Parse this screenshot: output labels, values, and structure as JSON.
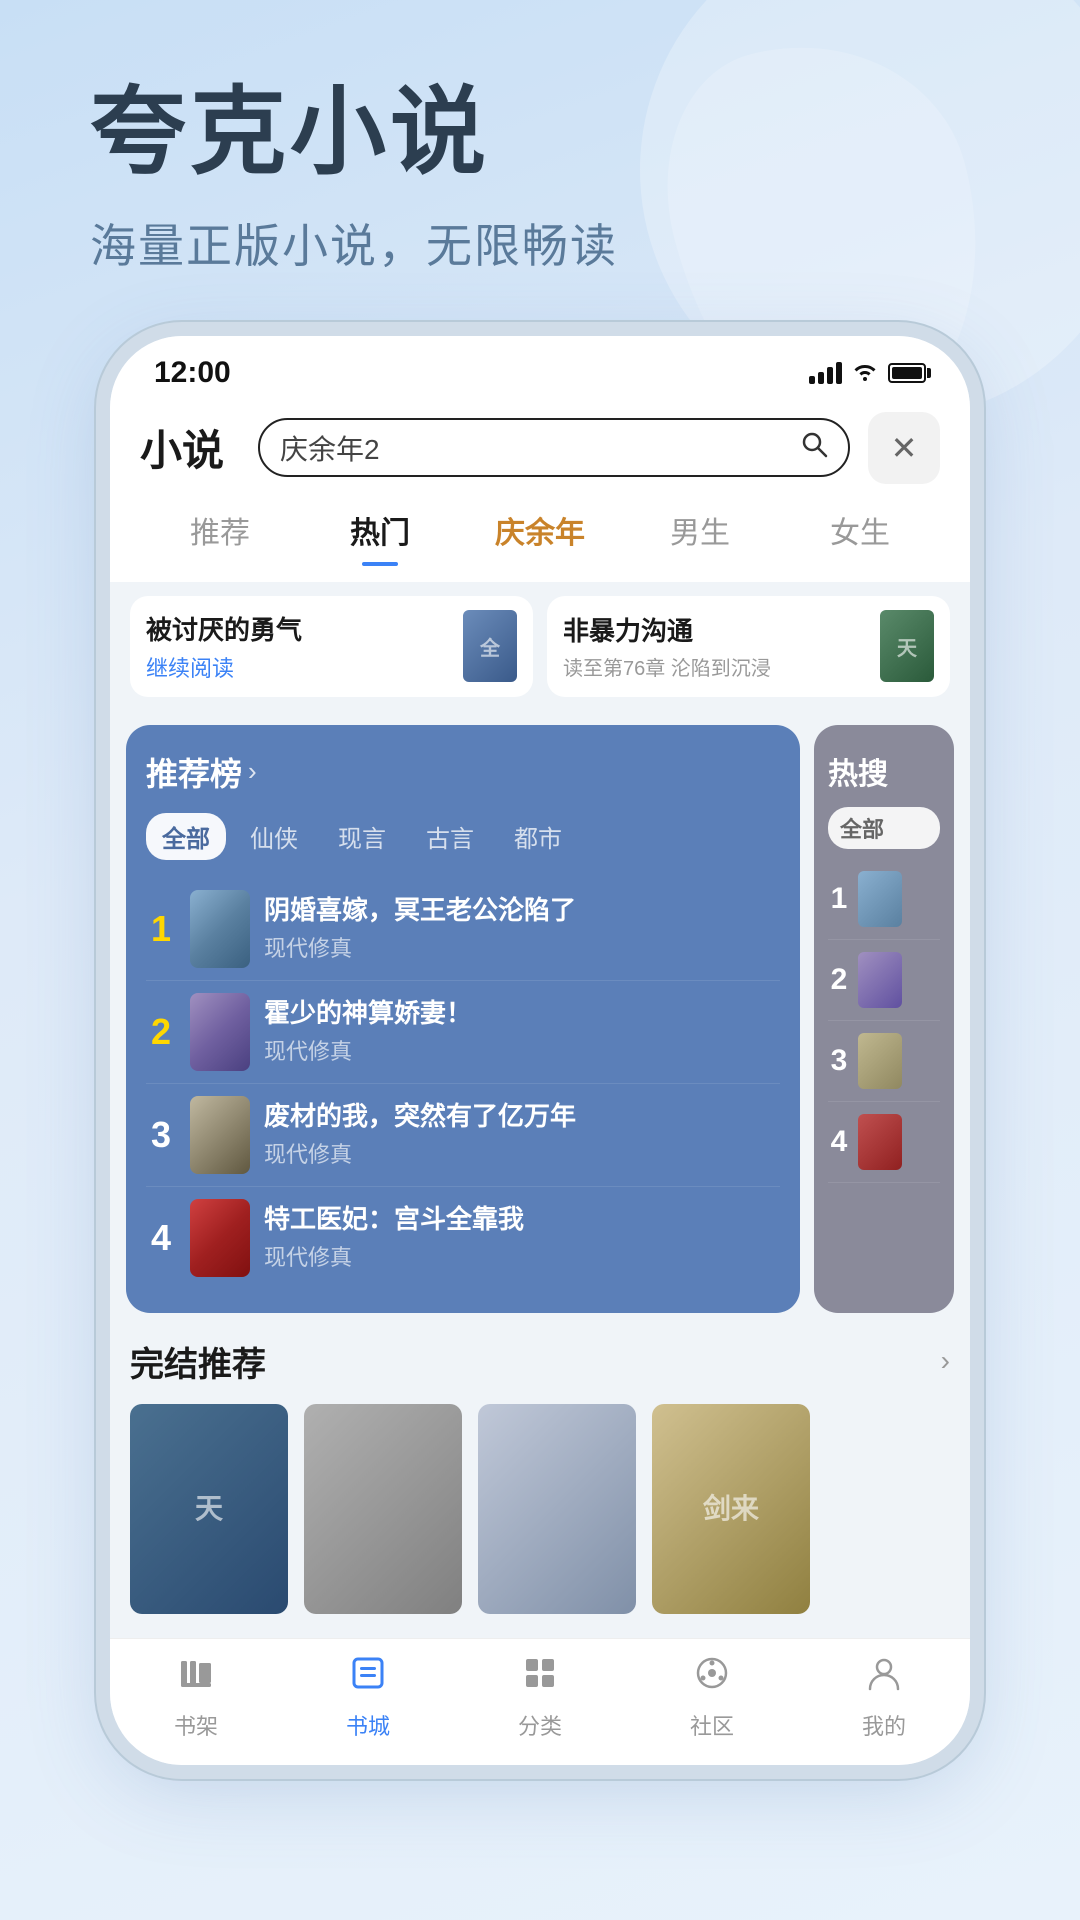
{
  "app": {
    "title": "夸克小说",
    "subtitle": "海量正版小说，无限畅读",
    "status_time": "12:00"
  },
  "header": {
    "logo": "小说",
    "search_placeholder": "庆余年2",
    "search_value": "庆余年2"
  },
  "nav_tabs": [
    {
      "label": "推荐",
      "active": false,
      "special": false
    },
    {
      "label": "热门",
      "active": true,
      "special": false
    },
    {
      "label": "庆余年",
      "active": false,
      "special": true
    },
    {
      "label": "男生",
      "active": false,
      "special": false
    },
    {
      "label": "女生",
      "active": false,
      "special": false
    }
  ],
  "recent_reads": [
    {
      "title": "被讨厌的勇气",
      "sub": "继续阅读",
      "sub_type": "action"
    },
    {
      "title": "非暴力沟通",
      "sub": "读至第76章 沦陷到沉浸",
      "sub_type": "progress"
    }
  ],
  "recommend_panel": {
    "title": "推荐榜",
    "arrow": "›",
    "filter_tabs": [
      "全部",
      "仙侠",
      "现言",
      "古言",
      "都市"
    ],
    "active_filter": "全部",
    "books": [
      {
        "rank": "1",
        "title": "阴婚喜嫁，冥王老公沦陷了",
        "genre": "现代修真",
        "cover_class": "cover-1"
      },
      {
        "rank": "2",
        "title": "霍少的神算娇妻！",
        "genre": "现代修真",
        "cover_class": "cover-2"
      },
      {
        "rank": "3",
        "title": "废材的我，突然有了亿万年",
        "genre": "现代修真",
        "cover_class": "cover-3"
      },
      {
        "rank": "4",
        "title": "特工医妃：宫斗全靠我",
        "genre": "现代修真",
        "cover_class": "cover-4"
      }
    ]
  },
  "hotsearch_panel": {
    "title": "热搜",
    "filter_tab": "全部",
    "books": [
      {
        "rank": "1",
        "cover_class": "hs-cover-1"
      },
      {
        "rank": "2",
        "cover_class": "hs-cover-2"
      },
      {
        "rank": "3",
        "cover_class": "hs-cover-3"
      },
      {
        "rank": "4",
        "cover_class": "hs-cover-4"
      }
    ]
  },
  "completed_section": {
    "title": "完结推荐",
    "arrow": "›",
    "books": [
      {
        "cover_class": "cc-1",
        "title": "天",
        "has_text": true,
        "text": "天"
      },
      {
        "cover_class": "cc-2",
        "title": "",
        "has_text": false
      },
      {
        "cover_class": "cc-3",
        "title": "",
        "has_text": false
      },
      {
        "cover_class": "cc-4",
        "title": "剑来",
        "has_text": true,
        "text": "剑来"
      }
    ]
  },
  "bottom_nav": [
    {
      "label": "书架",
      "icon": "📚",
      "active": false,
      "icon_type": "shelf"
    },
    {
      "label": "书城",
      "icon": "📖",
      "active": true,
      "icon_type": "city"
    },
    {
      "label": "分类",
      "icon": "⊞",
      "active": false,
      "icon_type": "category"
    },
    {
      "label": "社区",
      "icon": "💬",
      "active": false,
      "icon_type": "community"
    },
    {
      "label": "我的",
      "icon": "👤",
      "active": false,
      "icon_type": "profile"
    }
  ]
}
